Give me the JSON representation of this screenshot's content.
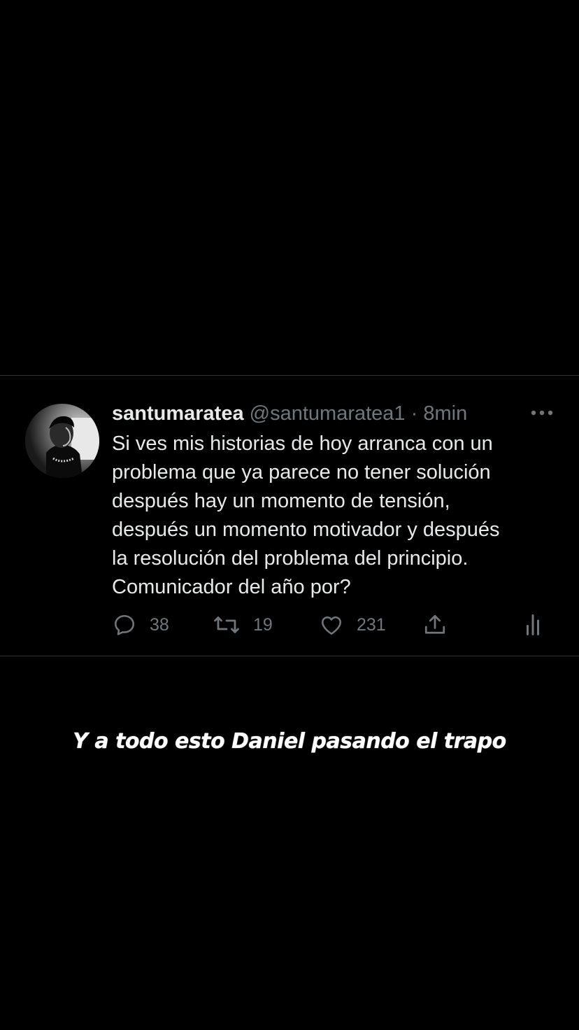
{
  "tweet": {
    "display_name": "santumaratea",
    "handle": "@santumaratea1",
    "separator": "·",
    "time": "8min",
    "text": "Si ves mis historias de hoy arranca con un\nproblema que ya parece no tener solución\ndespués hay un momento de tensión,\ndespués un momento motivador y después\nla resolución del problema del principio.\nComunicador del año por?",
    "actions": {
      "replies": "38",
      "retweets": "19",
      "likes": "231"
    }
  },
  "caption": "Y a todo esto Daniel pasando el trapo",
  "icons": {
    "avatar": "profile-photo",
    "more": "more-dots-icon",
    "reply": "reply-icon",
    "retweet": "retweet-icon",
    "like": "heart-icon",
    "share": "share-icon",
    "stats": "analytics-icon"
  },
  "colors": {
    "background": "#000000",
    "text": "#e7e9ea",
    "secondary": "#71767b",
    "divider": "#2f3336"
  }
}
